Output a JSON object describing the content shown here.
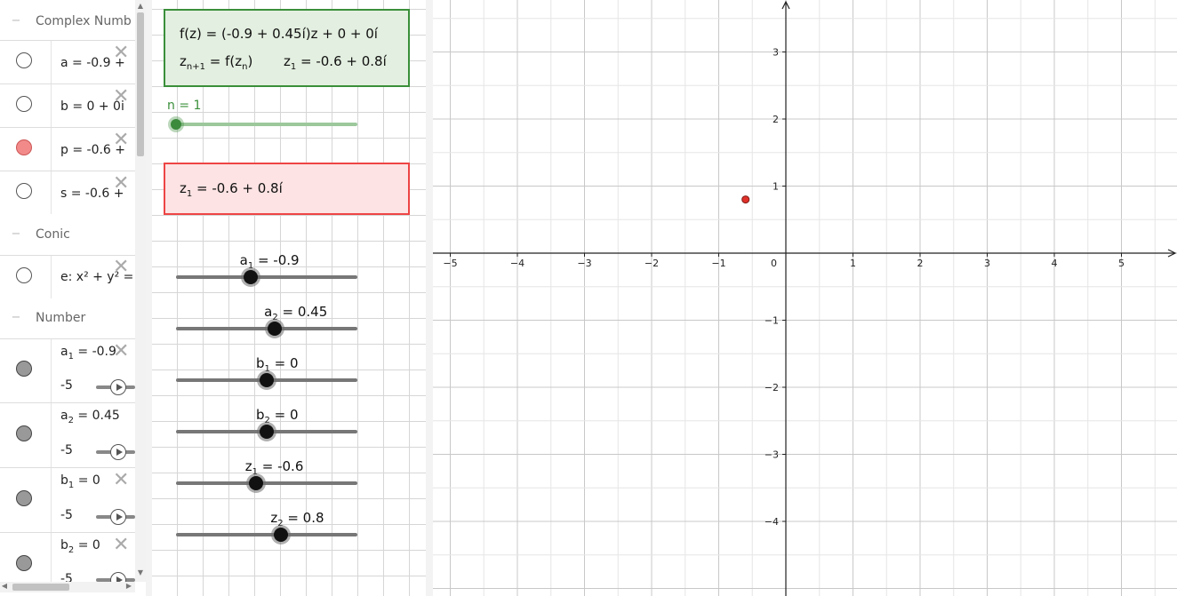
{
  "algebra": {
    "groups": [
      {
        "label": "Complex Numb"
      },
      {
        "label": "Conic"
      },
      {
        "label": "Number"
      }
    ],
    "complex_items": [
      {
        "expr": "a = -0.9 +"
      },
      {
        "expr": "b = 0 + 0i"
      },
      {
        "expr": "p = -0.6 +"
      },
      {
        "expr": "s = -0.6 +"
      }
    ],
    "conic_item": {
      "expr": "e: x² + y² ="
    },
    "number_items": [
      {
        "name": "a",
        "sub": "1",
        "value": " = -0.9",
        "min": "-5"
      },
      {
        "name": "a",
        "sub": "2",
        "value": " = 0.45",
        "min": "-5"
      },
      {
        "name": "b",
        "sub": "1",
        "value": " = 0",
        "min": "-5"
      },
      {
        "name": "b",
        "sub": "2",
        "value": " = 0",
        "min": "-5"
      }
    ],
    "toggle_glyph": "−"
  },
  "panel2": {
    "func_line": "f(z) = (-0.9 + 0.45í)z + 0 + 0í",
    "rec_z": "z",
    "rec_sub": "n+1",
    "rec_mid": " = f(z",
    "rec_sub2": "n",
    "rec_end": ")",
    "rec_z1": "z",
    "rec_z1_sub": "1",
    "rec_z1_val": " = -0.6 + 0.8í",
    "n_label": "n = 1",
    "red_z": "z",
    "red_sub": "1",
    "red_val": " = -0.6 + 0.8í",
    "sliders": [
      {
        "name": "a",
        "sub": "1",
        "value": " = -0.9",
        "level": 0.41
      },
      {
        "name": "a",
        "sub": "2",
        "value": " = 0.45",
        "level": 0.545
      },
      {
        "name": "b",
        "sub": "1",
        "value": " = 0",
        "level": 0.5
      },
      {
        "name": "b",
        "sub": "2",
        "value": " = 0",
        "level": 0.5
      },
      {
        "name": "z",
        "sub": "1",
        "value": " = -0.6",
        "level": 0.44
      },
      {
        "name": "z",
        "sub": "2",
        "value": " = 0.8",
        "level": 0.58
      }
    ],
    "n_level": 0.0
  },
  "graph": {
    "x_ticks": [
      "−5",
      "−4",
      "−3",
      "−2",
      "−1",
      "0",
      "1",
      "2",
      "3",
      "4",
      "5"
    ],
    "y_ticks": [
      "3",
      "2",
      "1",
      "−1",
      "−2",
      "−3",
      "−4"
    ],
    "point": {
      "x": -0.6,
      "y": 0.8
    },
    "point_color": "#e0302a"
  },
  "colors": {
    "green_border": "#3a8f3a",
    "red_border": "#ee4444"
  }
}
